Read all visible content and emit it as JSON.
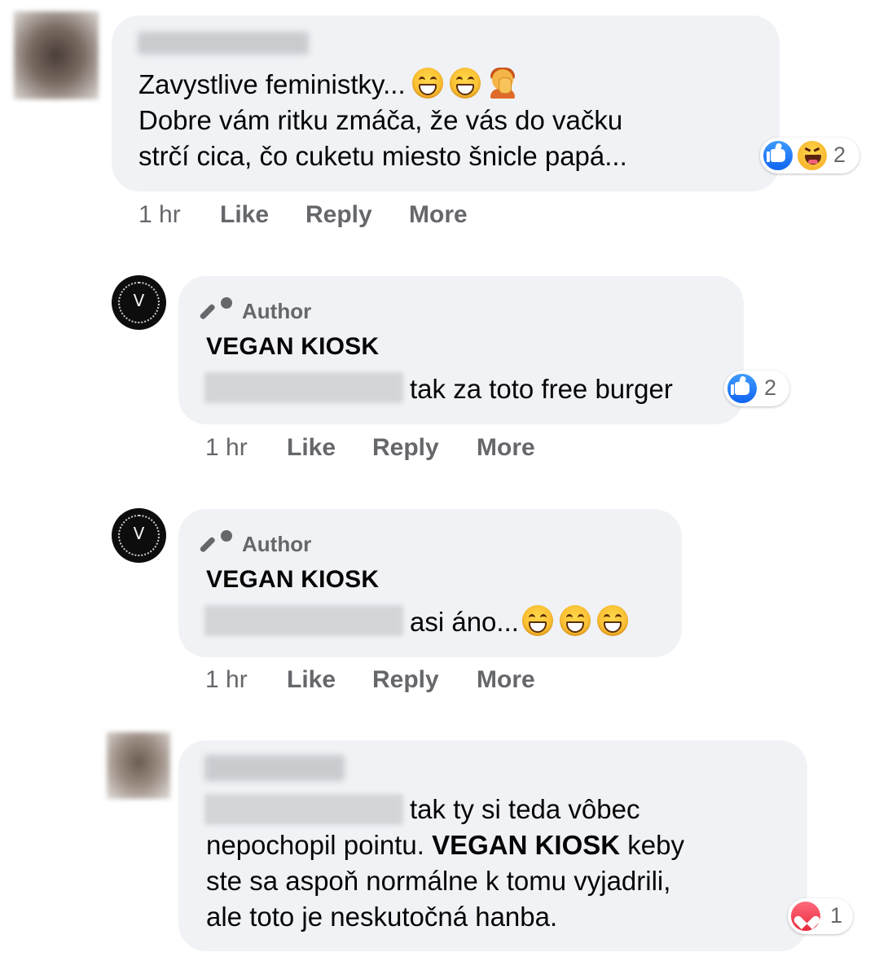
{
  "comments": [
    {
      "lines": [
        "Zavystlive feministky...",
        "Dobre vám ritku zmáča, že vás do vačku",
        "strčí cica, čo cuketu miesto šnicle papá..."
      ],
      "reaction_count": "2",
      "actions": {
        "time": "1 hr",
        "like": "Like",
        "reply": "Reply",
        "more": "More"
      }
    },
    {
      "badge": "Author",
      "page_name": "VEGAN KIOSK",
      "text": "tak za toto free burger",
      "reaction_count": "2",
      "actions": {
        "time": "1 hr",
        "like": "Like",
        "reply": "Reply",
        "more": "More"
      }
    },
    {
      "badge": "Author",
      "page_name": "VEGAN KIOSK",
      "text": "asi áno...",
      "actions": {
        "time": "1 hr",
        "like": "Like",
        "reply": "Reply",
        "more": "More"
      }
    },
    {
      "line1": "tak ty si teda vôbec",
      "line2_a": "nepochopil pointu. ",
      "line2_bold": "VEGAN KIOSK",
      "line2_b": " keby",
      "line3": "ste sa aspoň normálne k tomu vyjadrili,",
      "line4": "ale toto je neskutočná hanba.",
      "reaction_count": "1"
    }
  ],
  "avatar_letter": "V",
  "icons": {
    "author_badge": "microphone-icon",
    "reaction_like": "like-reaction-icon",
    "reaction_haha": "haha-reaction-icon",
    "reaction_love": "love-reaction-icon",
    "emoji_grin": "grinning-face-emoji",
    "emoji_facepalm": "facepalm-emoji",
    "emoji_smile": "smiling-face-emoji"
  },
  "colors": {
    "bubble": "#f0f2f5",
    "secondary_text": "#65676b",
    "like_blue": "#1877f2",
    "love_red": "#e8293d"
  }
}
